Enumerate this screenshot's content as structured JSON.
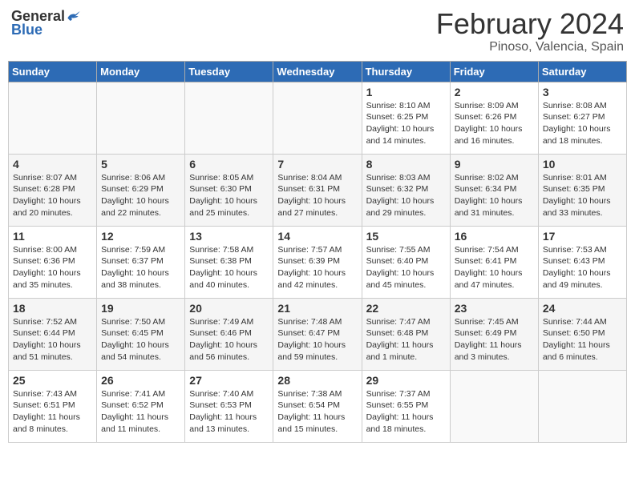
{
  "header": {
    "logo_general": "General",
    "logo_blue": "Blue",
    "month": "February 2024",
    "location": "Pinoso, Valencia, Spain"
  },
  "days_of_week": [
    "Sunday",
    "Monday",
    "Tuesday",
    "Wednesday",
    "Thursday",
    "Friday",
    "Saturday"
  ],
  "weeks": [
    [
      {
        "day": "",
        "info": ""
      },
      {
        "day": "",
        "info": ""
      },
      {
        "day": "",
        "info": ""
      },
      {
        "day": "",
        "info": ""
      },
      {
        "day": "1",
        "info": "Sunrise: 8:10 AM\nSunset: 6:25 PM\nDaylight: 10 hours\nand 14 minutes."
      },
      {
        "day": "2",
        "info": "Sunrise: 8:09 AM\nSunset: 6:26 PM\nDaylight: 10 hours\nand 16 minutes."
      },
      {
        "day": "3",
        "info": "Sunrise: 8:08 AM\nSunset: 6:27 PM\nDaylight: 10 hours\nand 18 minutes."
      }
    ],
    [
      {
        "day": "4",
        "info": "Sunrise: 8:07 AM\nSunset: 6:28 PM\nDaylight: 10 hours\nand 20 minutes."
      },
      {
        "day": "5",
        "info": "Sunrise: 8:06 AM\nSunset: 6:29 PM\nDaylight: 10 hours\nand 22 minutes."
      },
      {
        "day": "6",
        "info": "Sunrise: 8:05 AM\nSunset: 6:30 PM\nDaylight: 10 hours\nand 25 minutes."
      },
      {
        "day": "7",
        "info": "Sunrise: 8:04 AM\nSunset: 6:31 PM\nDaylight: 10 hours\nand 27 minutes."
      },
      {
        "day": "8",
        "info": "Sunrise: 8:03 AM\nSunset: 6:32 PM\nDaylight: 10 hours\nand 29 minutes."
      },
      {
        "day": "9",
        "info": "Sunrise: 8:02 AM\nSunset: 6:34 PM\nDaylight: 10 hours\nand 31 minutes."
      },
      {
        "day": "10",
        "info": "Sunrise: 8:01 AM\nSunset: 6:35 PM\nDaylight: 10 hours\nand 33 minutes."
      }
    ],
    [
      {
        "day": "11",
        "info": "Sunrise: 8:00 AM\nSunset: 6:36 PM\nDaylight: 10 hours\nand 35 minutes."
      },
      {
        "day": "12",
        "info": "Sunrise: 7:59 AM\nSunset: 6:37 PM\nDaylight: 10 hours\nand 38 minutes."
      },
      {
        "day": "13",
        "info": "Sunrise: 7:58 AM\nSunset: 6:38 PM\nDaylight: 10 hours\nand 40 minutes."
      },
      {
        "day": "14",
        "info": "Sunrise: 7:57 AM\nSunset: 6:39 PM\nDaylight: 10 hours\nand 42 minutes."
      },
      {
        "day": "15",
        "info": "Sunrise: 7:55 AM\nSunset: 6:40 PM\nDaylight: 10 hours\nand 45 minutes."
      },
      {
        "day": "16",
        "info": "Sunrise: 7:54 AM\nSunset: 6:41 PM\nDaylight: 10 hours\nand 47 minutes."
      },
      {
        "day": "17",
        "info": "Sunrise: 7:53 AM\nSunset: 6:43 PM\nDaylight: 10 hours\nand 49 minutes."
      }
    ],
    [
      {
        "day": "18",
        "info": "Sunrise: 7:52 AM\nSunset: 6:44 PM\nDaylight: 10 hours\nand 51 minutes."
      },
      {
        "day": "19",
        "info": "Sunrise: 7:50 AM\nSunset: 6:45 PM\nDaylight: 10 hours\nand 54 minutes."
      },
      {
        "day": "20",
        "info": "Sunrise: 7:49 AM\nSunset: 6:46 PM\nDaylight: 10 hours\nand 56 minutes."
      },
      {
        "day": "21",
        "info": "Sunrise: 7:48 AM\nSunset: 6:47 PM\nDaylight: 10 hours\nand 59 minutes."
      },
      {
        "day": "22",
        "info": "Sunrise: 7:47 AM\nSunset: 6:48 PM\nDaylight: 11 hours\nand 1 minute."
      },
      {
        "day": "23",
        "info": "Sunrise: 7:45 AM\nSunset: 6:49 PM\nDaylight: 11 hours\nand 3 minutes."
      },
      {
        "day": "24",
        "info": "Sunrise: 7:44 AM\nSunset: 6:50 PM\nDaylight: 11 hours\nand 6 minutes."
      }
    ],
    [
      {
        "day": "25",
        "info": "Sunrise: 7:43 AM\nSunset: 6:51 PM\nDaylight: 11 hours\nand 8 minutes."
      },
      {
        "day": "26",
        "info": "Sunrise: 7:41 AM\nSunset: 6:52 PM\nDaylight: 11 hours\nand 11 minutes."
      },
      {
        "day": "27",
        "info": "Sunrise: 7:40 AM\nSunset: 6:53 PM\nDaylight: 11 hours\nand 13 minutes."
      },
      {
        "day": "28",
        "info": "Sunrise: 7:38 AM\nSunset: 6:54 PM\nDaylight: 11 hours\nand 15 minutes."
      },
      {
        "day": "29",
        "info": "Sunrise: 7:37 AM\nSunset: 6:55 PM\nDaylight: 11 hours\nand 18 minutes."
      },
      {
        "day": "",
        "info": ""
      },
      {
        "day": "",
        "info": ""
      }
    ]
  ]
}
